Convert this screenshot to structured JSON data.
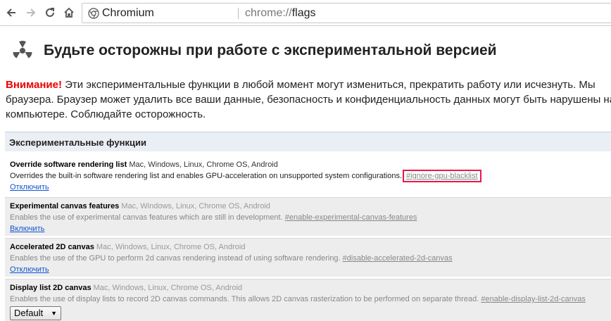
{
  "browser": {
    "back_label": "←",
    "forward_label": "→",
    "reload_label": "↻",
    "home_label": "⌂",
    "brand": "Chromium",
    "url_scheme": "chrome://",
    "url_host": "flags"
  },
  "page": {
    "title": "Будьте осторожны при работе с экспериментальной версией",
    "warning_label": "Внимание!",
    "warning_text": " Эти экспериментальные функции в любой момент могут измениться, прекратить работу или исчезнуть. Мы браузера. Браузер может удалить все ваши данные, безопасность и конфиденциальность данных могут быть нарушены на компьютере. Соблюдайте осторожность.",
    "section_title": "Экспериментальные функции"
  },
  "experiments": [
    {
      "name": "Override software rendering list",
      "platforms": "Mac, Windows, Linux, Chrome OS, Android",
      "description": "Overrides the built-in software rendering list and enables GPU-acceleration on unsupported system configurations.",
      "flag": "#ignore-gpu-blacklist",
      "action": "Отключить"
    },
    {
      "name": "Experimental canvas features",
      "platforms": "Mac, Windows, Linux, Chrome OS, Android",
      "description": "Enables the use of experimental canvas features which are still in development.",
      "flag": "#enable-experimental-canvas-features",
      "action": "Включить"
    },
    {
      "name": "Accelerated 2D canvas",
      "platforms": "Mac, Windows, Linux, Chrome OS, Android",
      "description": "Enables the use of the GPU to perform 2d canvas rendering instead of using software rendering.",
      "flag": "#disable-accelerated-2d-canvas",
      "action": "Отключить"
    },
    {
      "name": "Display list 2D canvas",
      "platforms": "Mac, Windows, Linux, Chrome OS, Android",
      "description": "Enables the use of display lists to record 2D canvas commands. This allows 2D canvas rasterization to be performed on separate thread.",
      "flag": "#enable-display-list-2d-canvas",
      "select_value": "Default"
    }
  ],
  "colors": {
    "highlight": "#e8184a",
    "link": "#1155cc",
    "warning": "#ee0000"
  }
}
